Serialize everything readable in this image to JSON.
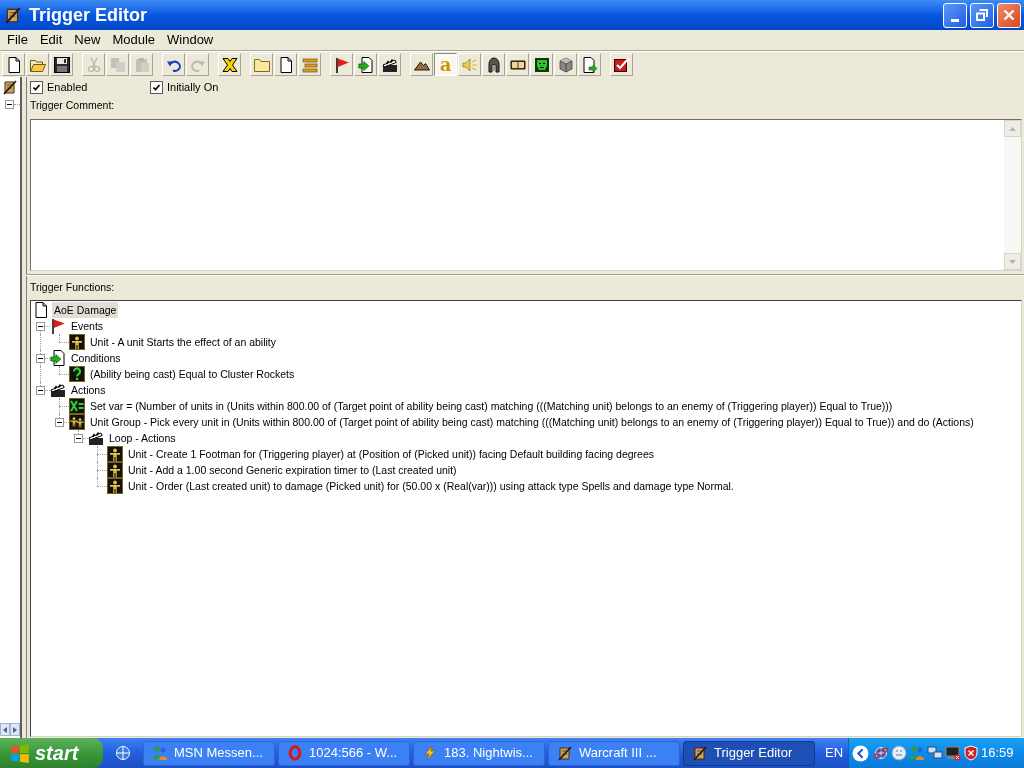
{
  "window": {
    "title": "Trigger Editor"
  },
  "menu": [
    "File",
    "Edit",
    "New",
    "Module",
    "Window"
  ],
  "toolbar": [
    [
      {
        "kind": "new",
        "disabled": false,
        "pressed": false
      },
      {
        "kind": "open",
        "disabled": false,
        "pressed": false
      },
      {
        "kind": "save",
        "disabled": false,
        "pressed": false
      }
    ],
    [
      {
        "kind": "cut",
        "disabled": true,
        "pressed": false
      },
      {
        "kind": "copy",
        "disabled": true,
        "pressed": false
      },
      {
        "kind": "paste",
        "disabled": true,
        "pressed": false
      }
    ],
    [
      {
        "kind": "undo",
        "disabled": false,
        "pressed": false
      },
      {
        "kind": "redo",
        "disabled": true,
        "pressed": false
      }
    ],
    [
      {
        "kind": "x",
        "disabled": false,
        "pressed": false
      }
    ],
    [
      {
        "kind": "folder",
        "disabled": false,
        "pressed": false
      },
      {
        "kind": "page",
        "disabled": false,
        "pressed": false
      },
      {
        "kind": "list",
        "disabled": false,
        "pressed": false
      }
    ],
    [
      {
        "kind": "flag",
        "disabled": false,
        "pressed": false
      },
      {
        "kind": "page_arrow",
        "disabled": false,
        "pressed": false
      },
      {
        "kind": "clapper",
        "disabled": false,
        "pressed": false
      }
    ],
    [
      {
        "kind": "terrain",
        "disabled": false,
        "pressed": false
      },
      {
        "kind": "glyph",
        "glyph": "a",
        "disabled": false,
        "pressed": true
      },
      {
        "kind": "sound",
        "disabled": false,
        "pressed": false
      },
      {
        "kind": "helmet",
        "disabled": false,
        "pressed": false
      },
      {
        "kind": "book",
        "disabled": false,
        "pressed": false
      },
      {
        "kind": "face",
        "disabled": false,
        "pressed": false
      },
      {
        "kind": "cube",
        "disabled": false,
        "pressed": false
      },
      {
        "kind": "page_arrow_corner",
        "disabled": false,
        "pressed": false
      }
    ],
    [
      {
        "kind": "check",
        "disabled": false,
        "pressed": false
      }
    ]
  ],
  "trigger_list": {
    "folders": [
      {
        "expanded": true
      }
    ]
  },
  "options": {
    "checkboxes": [
      {
        "label": "Enabled",
        "checked": true
      },
      {
        "label": "Initially On",
        "checked": true
      }
    ]
  },
  "comment": {
    "label": "Trigger Comment:"
  },
  "functions": {
    "label": "Trigger Functions:",
    "tree": {
      "kind": "trigger",
      "label": "AoE Damage",
      "selected": true,
      "children": [
        {
          "kind": "events",
          "label": "Events",
          "selected": false,
          "expanded": true,
          "children": [
            {
              "kind": "unit",
              "label": "Unit - A unit Starts the effect of an ability",
              "selected": false
            }
          ]
        },
        {
          "kind": "conditions",
          "label": "Conditions",
          "selected": false,
          "expanded": true,
          "children": [
            {
              "kind": "question",
              "label": "(Ability being cast) Equal to Cluster Rockets",
              "selected": false
            }
          ]
        },
        {
          "kind": "actions",
          "label": "Actions",
          "selected": false,
          "expanded": true,
          "children": [
            {
              "kind": "variable",
              "label": "Set var = (Number of units in (Units within 800.00 of (Target point of ability being cast) matching (((Matching unit) belongs to an enemy of (Triggering player)) Equal to True)))",
              "selected": false
            },
            {
              "kind": "unit_group",
              "label": "Unit Group - Pick every unit in (Units within 800.00 of (Target point of ability being cast) matching (((Matching unit) belongs to an enemy of (Triggering player)) Equal to True)) and do (Actions)",
              "selected": false,
              "expanded": true,
              "children": [
                {
                  "kind": "actions",
                  "label": "Loop - Actions",
                  "selected": false,
                  "expanded": true,
                  "children": [
                    {
                      "kind": "unit",
                      "label": "Unit - Create 1 Footman for (Triggering player) at (Position of (Picked unit)) facing Default building facing degrees",
                      "selected": false
                    },
                    {
                      "kind": "unit",
                      "label": "Unit - Add a 1.00 second Generic expiration timer to (Last created unit)",
                      "selected": false
                    },
                    {
                      "kind": "unit",
                      "label": "Unit - Order (Last created unit) to damage (Picked unit) for (50.00 x (Real(var))) using attack type Spells and damage type Normal.",
                      "selected": false
                    }
                  ]
                }
              ]
            }
          ]
        }
      ]
    }
  },
  "taskbar": {
    "start": "start",
    "tasks": [
      {
        "label": "MSN Messen...",
        "kind": "msn",
        "selected": false
      },
      {
        "label": "1024:566 - W...",
        "kind": "opera",
        "selected": false
      },
      {
        "label": "183. Nightwis...",
        "kind": "winamp",
        "selected": false
      },
      {
        "label": "Warcraft III ...",
        "kind": "scroll",
        "selected": false
      },
      {
        "label": "Trigger Editor",
        "kind": "scroll",
        "selected": true
      }
    ],
    "language": "EN",
    "clock": "16:59"
  }
}
